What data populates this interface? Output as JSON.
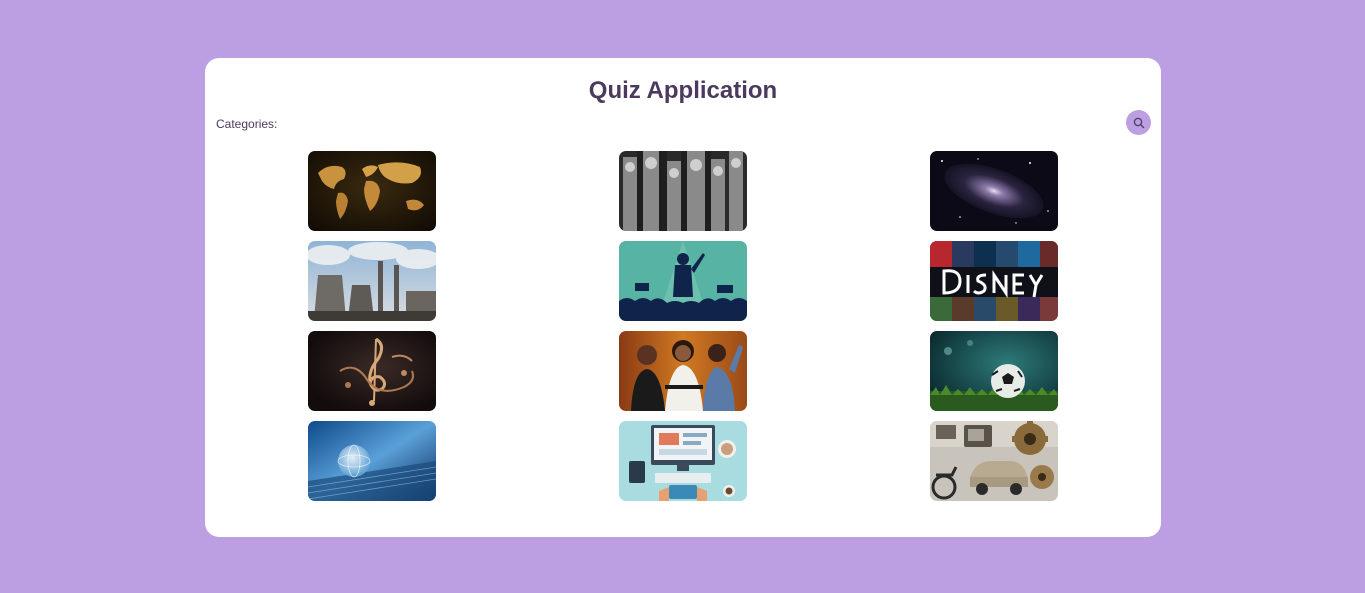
{
  "app": {
    "title": "Quiz Application"
  },
  "categories": {
    "label": "Categories:",
    "search_icon": "search-icon",
    "accent_color": "#bc9fe2",
    "items": [
      {
        "id": "geography",
        "image": "world-map-image"
      },
      {
        "id": "history",
        "image": "ancient-statues-image"
      },
      {
        "id": "space",
        "image": "galaxy-image"
      },
      {
        "id": "environment",
        "image": "power-plant-image"
      },
      {
        "id": "politics",
        "image": "speaker-crowd-image"
      },
      {
        "id": "movies",
        "image": "disney-movies-image"
      },
      {
        "id": "music",
        "image": "treble-clef-image"
      },
      {
        "id": "celebrities",
        "image": "celebrities-image"
      },
      {
        "id": "sports",
        "image": "soccer-ball-image"
      },
      {
        "id": "technology",
        "image": "digital-globe-image"
      },
      {
        "id": "computers",
        "image": "computer-desk-image"
      },
      {
        "id": "inventions",
        "image": "vintage-machines-image"
      }
    ]
  }
}
